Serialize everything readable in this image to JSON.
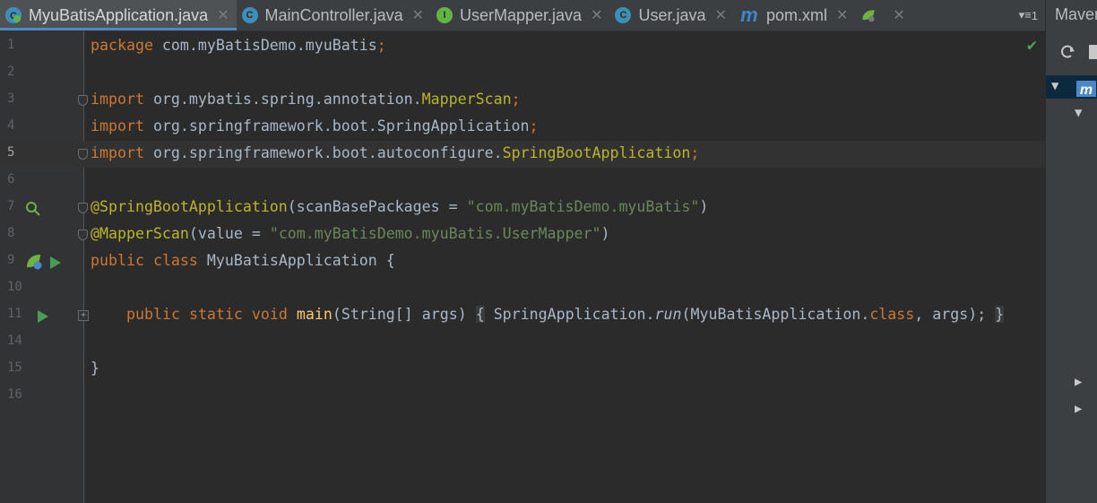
{
  "tabs": [
    {
      "label": "MyuBatisApplication.java",
      "icon": "spring-app-icon",
      "active": true
    },
    {
      "label": "MainController.java",
      "icon": "class-icon",
      "active": false
    },
    {
      "label": "UserMapper.java",
      "icon": "interface-icon",
      "active": false
    },
    {
      "label": "User.java",
      "icon": "class-icon",
      "active": false
    },
    {
      "label": "pom.xml",
      "icon": "maven-icon",
      "active": false
    }
  ],
  "tab_overflow": "1",
  "maven_panel": {
    "title": "Maven"
  },
  "lines": [
    "1",
    "2",
    "3",
    "4",
    "5",
    "6",
    "7",
    "8",
    "9",
    "10",
    "11",
    "14",
    "15",
    "16"
  ],
  "code": {
    "pkg_kw": "package",
    "pkg": " com.myBatisDemo.myuBatis",
    "semi": ";",
    "imp_kw": "import",
    "imp1_a": " org.mybatis.spring.annotation.",
    "imp1_b": "MapperScan",
    "imp2_a": " org.springframework.boot.SpringApplication",
    "imp3_a": " org.springframework.boot.autoconfigure.",
    "imp3_b": "SpringBootApplication",
    "ann1": "@SpringBootApplication",
    "ann1_open": "(scanBasePackages = ",
    "ann1_str": "\"com.myBatisDemo.myuBatis\"",
    "close_paren": ")",
    "ann2": "@MapperScan",
    "ann2_open": "(value = ",
    "ann2_str": "\"com.myBatisDemo.myuBatis.UserMapper\"",
    "public_kw": "public",
    "class_kw": "class",
    "class_name": " MyuBatisApplication {",
    "static_kw": "static",
    "void_kw": "void",
    "main_fn": "main",
    "main_args": "(String[] args)",
    "brace_open": "{",
    "sa": " SpringApplication.",
    "run": "run",
    "sa_args": "(MyuBatisApplication.",
    "class_lit": "class",
    "args_end": ", args);",
    "brace_close": "}",
    "closing": "}"
  }
}
